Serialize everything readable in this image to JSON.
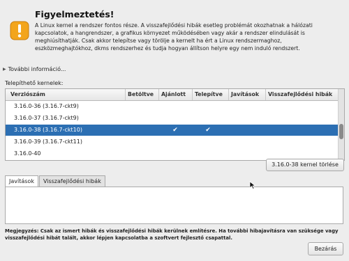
{
  "dialog": {
    "title": "Figyelmeztetés!",
    "description": "A Linux kernel a rendszer fontos része. A visszafejlődési hibák esetleg problémát okozhatnak a hálózati kapcsolatok, a hangrendszer, a grafikus környezet működésében vagy akár a rendszer elindulását is meghiúsíthatják. Csak akkor telepítse vagy törölje a kernelt ha ért a Linux rendszermaghoz, eszközmeghajtókhoz, dkms rendszerhez és tudja hogyan állítson helyre egy nem induló rendszert.",
    "more_info": "További információ...",
    "icon": "warning-icon"
  },
  "kernels": {
    "label": "Telepíthető kernelek:",
    "columns": [
      "Verziószám",
      "Betöltve",
      "Ajánlott",
      "Telepítve",
      "Javítások",
      "Visszafejlődési hibák"
    ],
    "rows": [
      {
        "version": "3.16.0-36 (3.16.7-ckt9)",
        "loaded": "",
        "recommended": "",
        "installed": "",
        "selected": false
      },
      {
        "version": "3.16.0-37 (3.16.7-ckt9)",
        "loaded": "",
        "recommended": "",
        "installed": "",
        "selected": false
      },
      {
        "version": "3.16.0-38 (3.16.7-ckt10)",
        "loaded": "",
        "recommended": "✔",
        "installed": "✔",
        "selected": true
      },
      {
        "version": "3.16.0-39 (3.16.7-ckt11)",
        "loaded": "",
        "recommended": "",
        "installed": "",
        "selected": false
      },
      {
        "version": "3.16.0-40",
        "loaded": "",
        "recommended": "",
        "installed": "",
        "selected": false
      }
    ]
  },
  "actions": {
    "remove_label": "3.16.0-38 kernel törlése",
    "close_label": "Bezárás"
  },
  "tabs": [
    {
      "label": "Javítások",
      "active": true
    },
    {
      "label": "Visszafejlődési hibák",
      "active": false
    }
  ],
  "note": "Megjegyzés: Csak az ismert hibák és visszafejlődési hibák kerülnek említésre. Ha további hibajavításra van szüksége vagy visszafejlődési hibát talált, akkor lépjen kapcsolatba a szoftvert fejlesztő csapattal.",
  "colors": {
    "selection": "#2c6fb3",
    "warning": "#f0a020"
  }
}
